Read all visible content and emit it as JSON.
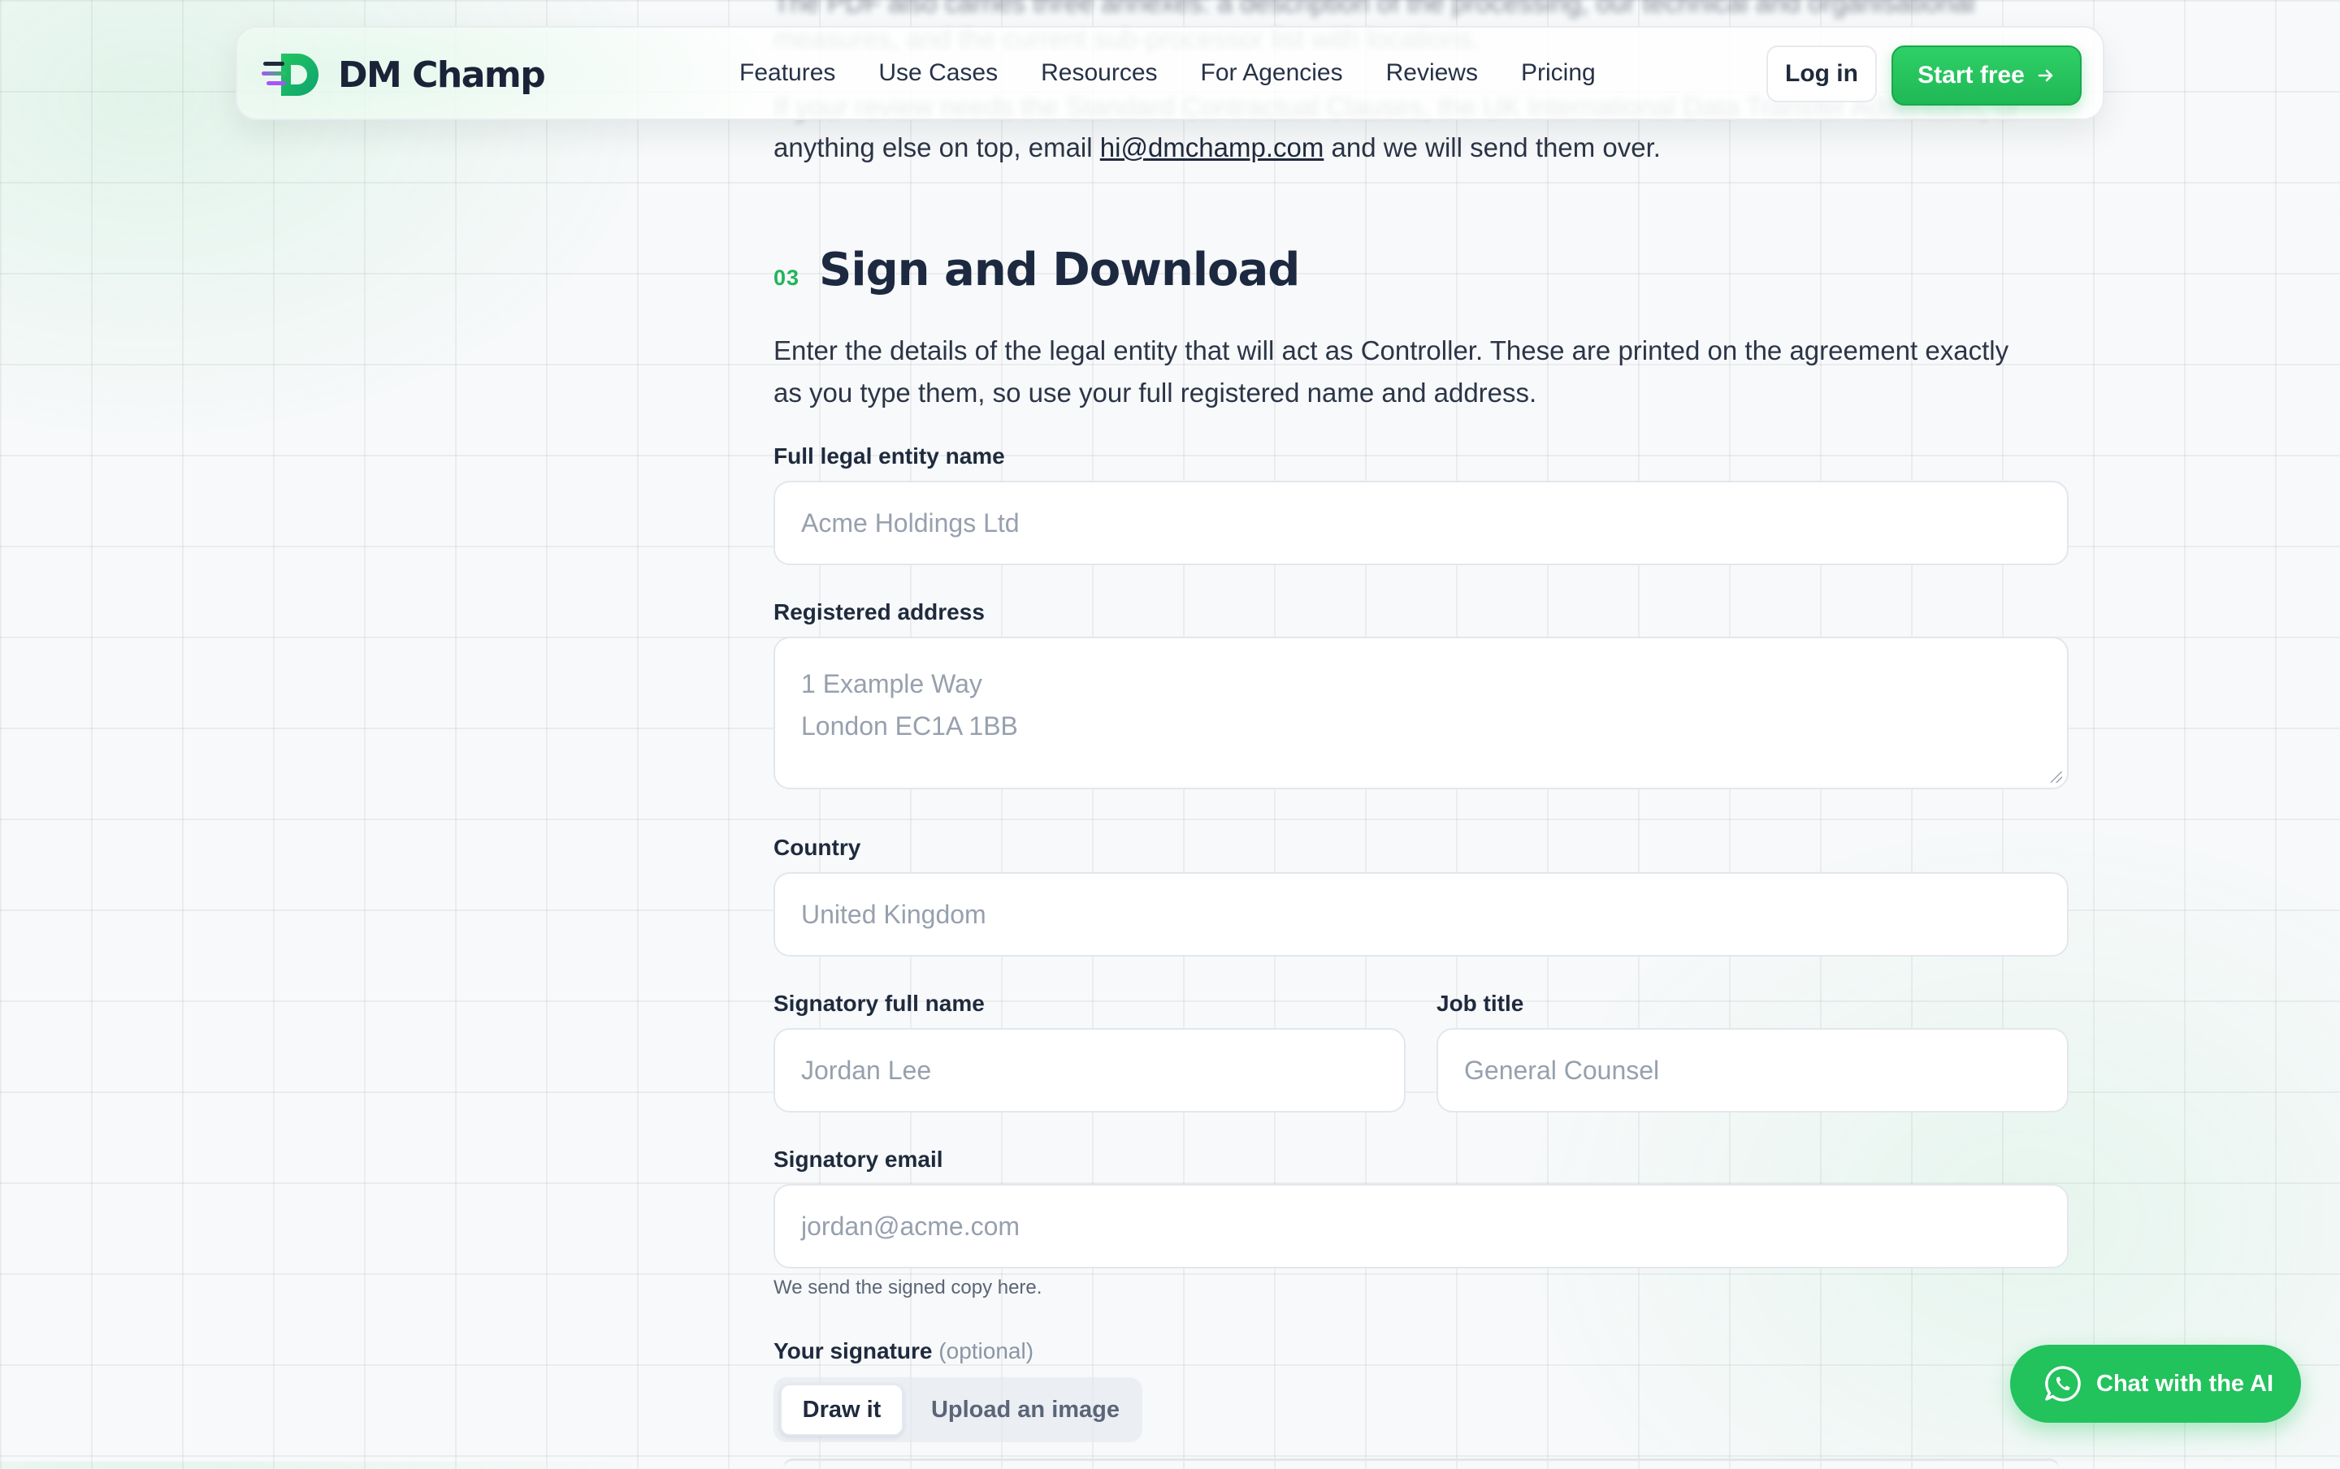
{
  "nav": {
    "brand": "DM Champ",
    "links": [
      "Features",
      "Use Cases",
      "Resources",
      "For Agencies",
      "Reviews",
      "Pricing"
    ],
    "login_label": "Log in",
    "cta_label": "Start free"
  },
  "prev_section": {
    "line1": "The PDF also carries three annexes: a description of the processing, our technical and organisational",
    "line2": "measures, and the current sub-processor list with locations.",
    "line3": "If your review needs the Standard Contractual Clauses, the UK International Data Transfer Addendum, or",
    "line4_before": "anything else on top, email ",
    "line4_link": "hi@dmchamp.com",
    "line4_after": " and we will send them over."
  },
  "section": {
    "number": "03",
    "title": "Sign and Download",
    "intro_line1": "Enter the details of the legal entity that will act as Controller. These are printed on the agreement exactly",
    "intro_line2": "as you type them, so use your full registered name and address."
  },
  "form": {
    "entity_label": "Full legal entity name",
    "entity_placeholder": "Acme Holdings Ltd",
    "entity_value": "",
    "address_label": "Registered address",
    "address_placeholder_line1": "1 Example Way",
    "address_placeholder_line2": "London EC1A 1BB",
    "country_label": "Country",
    "country_placeholder": "United Kingdom",
    "signatory_label": "Signatory full name",
    "signatory_placeholder": "Jordan Lee",
    "job_label": "Job title",
    "job_placeholder": "General Counsel",
    "email_label": "Signatory email",
    "email_placeholder": "jordan@acme.com",
    "email_help": "We send the signed copy here.",
    "signature_label": "Your signature",
    "signature_optional": "(optional)",
    "tab_draw": "Draw it",
    "tab_upload": "Upload an image"
  },
  "chat": {
    "label": "Chat with the AI"
  },
  "colors": {
    "accent": "#22c25d",
    "text": "#1f2a3d",
    "placeholder": "#97a0ae"
  }
}
